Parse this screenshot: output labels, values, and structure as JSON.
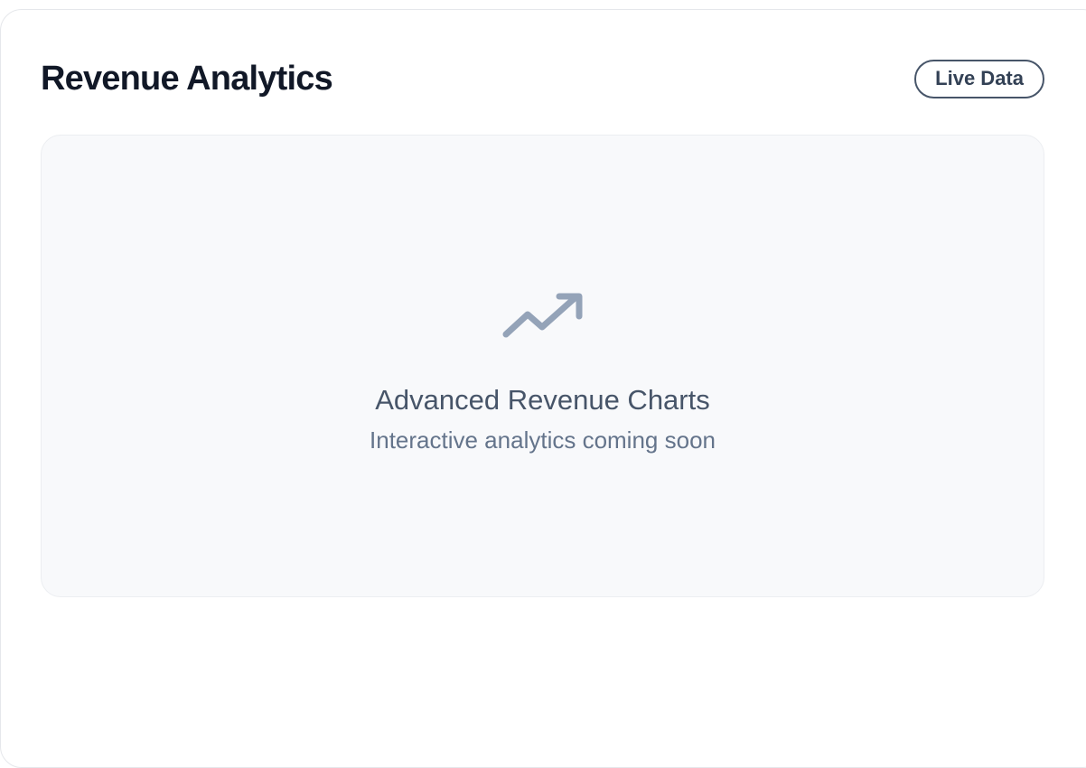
{
  "card": {
    "title": "Revenue Analytics",
    "badge_label": "Live Data"
  },
  "placeholder": {
    "icon": "trending-up-icon",
    "heading": "Advanced Revenue Charts",
    "subheading": "Interactive analytics coming soon"
  },
  "colors": {
    "title": "#111827",
    "badge_border": "#475569",
    "placeholder_bg": "#f8f9fb",
    "icon": "#94a3b8",
    "heading": "#475569",
    "subheading": "#64748b"
  }
}
